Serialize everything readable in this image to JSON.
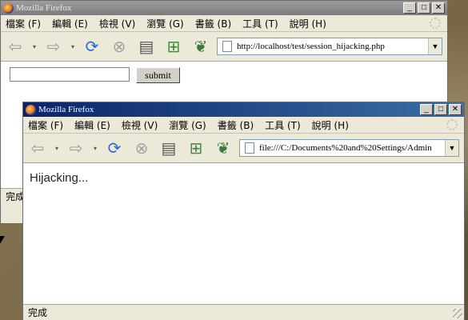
{
  "back_window": {
    "title": "Mozilla Firefox",
    "menu": [
      "檔案 (F)",
      "編輯 (E)",
      "檢視 (V)",
      "瀏覽 (G)",
      "書籤 (B)",
      "工具 (T)",
      "說明 (H)"
    ],
    "url": "http://localhost/test/session_hijacking.php",
    "form": {
      "input_value": "",
      "submit_label": "submit"
    },
    "status": "完成"
  },
  "front_window": {
    "title": "Mozilla Firefox",
    "menu": [
      "檔案 (F)",
      "編輯 (E)",
      "檢視 (V)",
      "瀏覽 (G)",
      "書籤 (B)",
      "工具 (T)",
      "說明 (H)"
    ],
    "url": "file:///C:/Documents%20and%20Settings/Admin",
    "content_text": "Hijacking...",
    "status": "完成"
  },
  "win_controls": {
    "minimize": "_",
    "maximize": "□",
    "close": "✕"
  },
  "icons": [
    "back-icon",
    "forward-icon",
    "reload-icon",
    "stop-icon",
    "print-icon",
    "newtab-icon",
    "leaf-icon"
  ]
}
